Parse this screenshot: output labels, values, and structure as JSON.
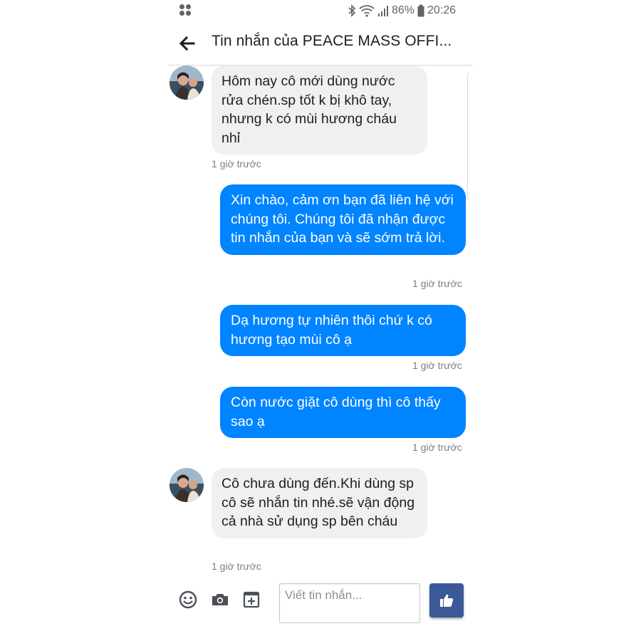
{
  "status_bar": {
    "battery": "86%",
    "time": "20:26"
  },
  "header": {
    "title": "Tin nhắn của PEACE MASS OFFI..."
  },
  "messages": [
    {
      "direction": "incoming",
      "text": "Hôm nay cô mới dùng nước rửa chén.sp tốt k bị khô tay, nhưng k có mùi hương cháu nhỉ",
      "time": "1 giờ trước"
    },
    {
      "direction": "outgoing",
      "text": "Xin chào, cảm ơn bạn đã liên hệ với chúng tôi. Chúng tôi đã nhận được tin nhắn của bạn và sẽ sớm trả lời.",
      "time": "1 giờ trước"
    },
    {
      "direction": "outgoing",
      "text": "Dạ hương tự nhiên thôi chứ k có hương tạo mùi cô ạ",
      "time": "1 giờ trước"
    },
    {
      "direction": "outgoing",
      "text": "Còn nước giặt cô dùng thì cô thấy sao ạ",
      "time": "1 giờ trước"
    },
    {
      "direction": "incoming",
      "text": "Cô chưa dùng đến.Khi dùng sp cô sẽ nhắn tin nhé.sẽ vận động cả nhà sử dụng sp bên cháu",
      "time": "1 giờ trước"
    }
  ],
  "composer": {
    "placeholder": "Viết tin nhắn...",
    "icons": [
      "emoji-icon",
      "camera-icon",
      "add-media-icon",
      "thumbs-up-icon"
    ]
  },
  "colors": {
    "outgoing_bubble": "#0084ff",
    "incoming_bubble": "#f1f0f0",
    "like_button": "#3b5998"
  }
}
